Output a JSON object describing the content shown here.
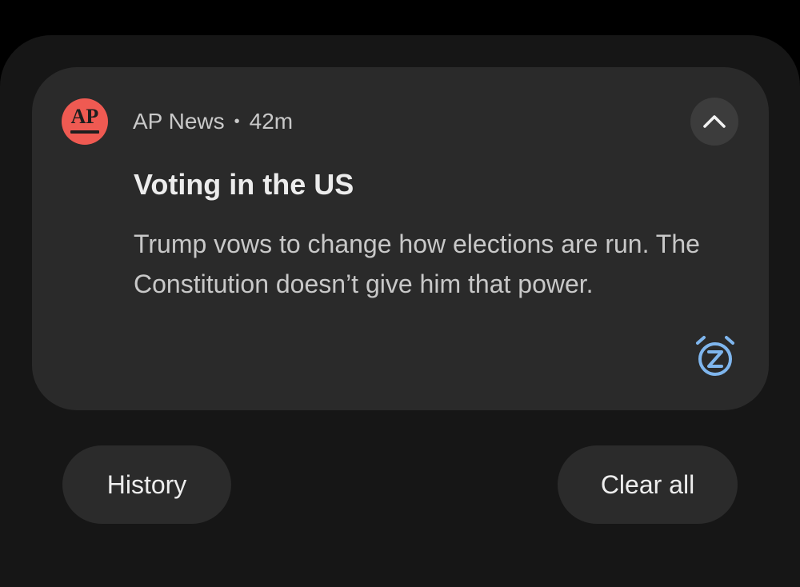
{
  "notification": {
    "app_name": "AP News",
    "separator": "•",
    "time": "42m",
    "app_icon": {
      "name": "ap-news-logo-icon",
      "text": "AP",
      "color": "#ef5a52"
    },
    "title": "Voting in the US",
    "body": "Trump vows to change how elections are run. The Constitution doesn’t give him that power.",
    "expand_icon": "chevron-up-icon",
    "snooze_icon": "snooze-alarm-icon",
    "snooze_color": "#7fb6ee"
  },
  "actions": {
    "history_label": "History",
    "clear_all_label": "Clear all"
  }
}
